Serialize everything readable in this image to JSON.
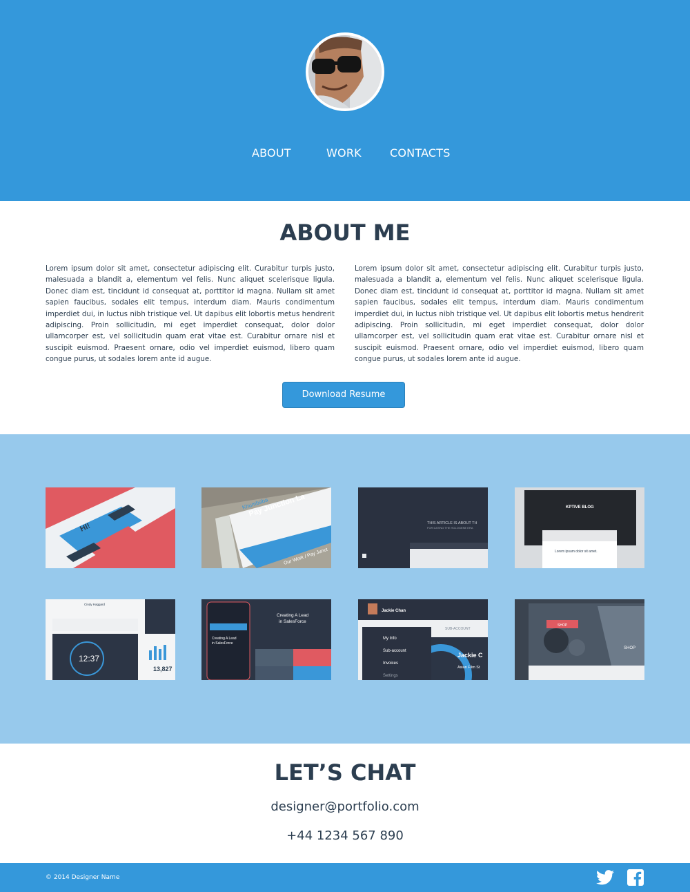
{
  "colors": {
    "primary": "#3498db",
    "light_band": "#97c9ec",
    "text_dark": "#2c3e50",
    "white": "#ffffff"
  },
  "nav": {
    "about": "ABOUT",
    "work": "WORK",
    "contacts": "CONTACTS"
  },
  "about": {
    "title": "ABOUT ME",
    "paragraph_left": "Lorem ipsum dolor sit amet, consectetur adipiscing elit. Curabitur turpis justo, malesuada a blandit a, elementum vel felis. Nunc aliquet scelerisque ligula. Donec diam est, tincidunt id consequat at, porttitor id magna. Nullam sit amet sapien faucibus, sodales elit tempus, interdum diam. Mauris condimentum imperdiet dui, in luctus nibh tristique vel. Ut dapibus elit lobortis metus hendrerit adipiscing. Proin sollicitudin, mi eget imperdiet consequat, dolor dolor ullamcorper est, vel sollicitudin quam erat vitae est. Curabitur ornare nisl et suscipit euismod. Praesent ornare, odio vel imperdiet euismod, libero quam congue purus, ut sodales lorem ante id augue.",
    "paragraph_right": "Lorem ipsum dolor sit amet, consectetur adipiscing elit. Curabitur turpis justo, malesuada a blandit a, elementum vel felis. Nunc aliquet scelerisque ligula. Donec diam est, tincidunt id consequat at, porttitor id magna. Nullam sit amet sapien faucibus, sodales elit tempus, interdum diam. Mauris condimentum imperdiet dui, in luctus nibh tristique vel. Ut dapibus elit lobortis metus hendrerit adipiscing. Proin sollicitudin, mi eget imperdiet consequat, dolor dolor ullamcorper est, vel sollicitudin quam erat vitae est. Curabitur ornare nisl et suscipit euismod. Praesent ornare, odio vel imperdiet euismod, libero quam congue purus, ut sodales lorem ante id augue.",
    "button_label": "Download Resume"
  },
  "work": {
    "thumbs": [
      {
        "labels": [
          "HI!"
        ]
      },
      {
        "labels": [
          "Khumbaba",
          "Pay Junction La",
          "Our Work / Pay Junct"
        ]
      },
      {
        "labels": [
          "THIS ARTICLE IS ABOUT TH",
          "FOR DATING THE HOLOGENE ERA"
        ]
      },
      {
        "labels": [
          "KPTIVE BLOG",
          "Lorem ipsum dolor sit amet."
        ]
      },
      {
        "labels": [
          "Cindy Haggard",
          "12:37",
          "13,827"
        ]
      },
      {
        "labels": [
          "Creating A Lead",
          "in SalesForce",
          "Creating A Lead",
          "in SalesForce"
        ]
      },
      {
        "labels": [
          "Jackie Chan",
          "SUB-ACCOUNT",
          "My Info",
          "Sub-account",
          "Invoices",
          "Settings",
          "Jackie C",
          "Asian Film St"
        ]
      },
      {
        "labels": [
          "SHOP",
          "SHOP"
        ]
      }
    ]
  },
  "chat": {
    "title": "LET’S CHAT",
    "email": "designer@portfolio.com",
    "phone": "+44 1234 567 890"
  },
  "footer": {
    "copyright": "© 2014 Designer Name"
  },
  "icons": {
    "twitter": "twitter-icon",
    "facebook": "facebook-icon"
  }
}
